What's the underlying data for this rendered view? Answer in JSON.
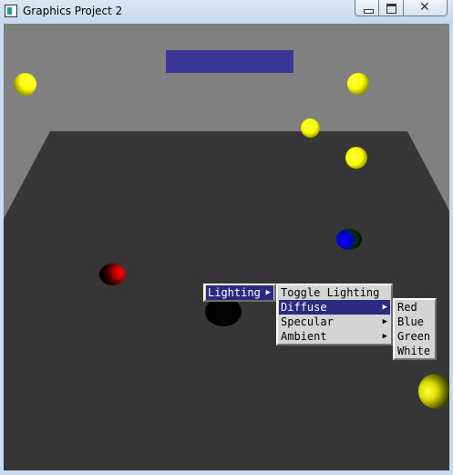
{
  "window": {
    "title": "Graphics Project 2"
  },
  "titlebar_buttons": {
    "minimize": "—",
    "maximize": "▭",
    "close": "✕"
  },
  "menus": {
    "root": {
      "items": [
        {
          "label": "Lighting",
          "arrow": "▶"
        }
      ]
    },
    "lighting": {
      "items": [
        {
          "label": "Toggle Lighting"
        },
        {
          "label": "Diffuse",
          "arrow": "▶"
        },
        {
          "label": "Specular",
          "arrow": "▶"
        },
        {
          "label": "Ambient",
          "arrow": "▶"
        }
      ]
    },
    "diffuse": {
      "items": [
        {
          "label": "Red"
        },
        {
          "label": "Blue"
        },
        {
          "label": "Green"
        },
        {
          "label": "White"
        }
      ]
    }
  },
  "colors": {
    "background": "#808080",
    "floor": "#363636",
    "overlay_rect": "#383898",
    "sphere": "#ffff00",
    "menu_highlight": "#2b2b82"
  },
  "icons": [
    "app-icon",
    "submenu-arrow-icon"
  ]
}
